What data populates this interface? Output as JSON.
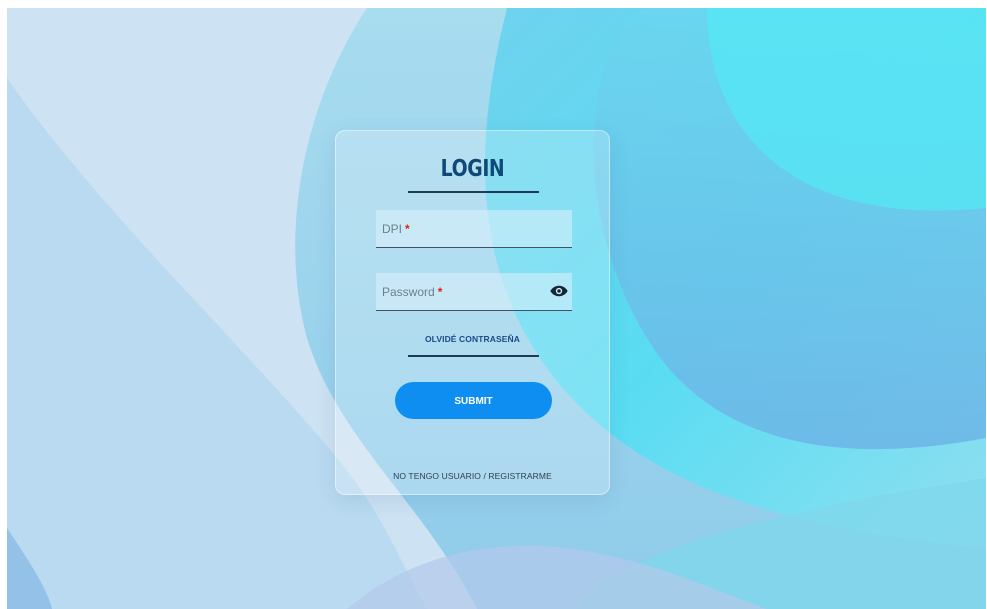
{
  "login": {
    "title": "LOGIN",
    "dpi_label": "DPI",
    "password_label": "Password",
    "required_mark": "*",
    "forgot_label": "OLVIDÉ CONTRASEÑA",
    "submit_label": "SUBMIT",
    "register_label": "NO TENGO USUARIO / REGISTRARME"
  },
  "icons": {
    "password_toggle": "eye-icon"
  },
  "colors": {
    "title": "#0f4978",
    "submit_button": "#0e8ef0",
    "required_mark": "#e0201e",
    "link": "#1d4a8a"
  }
}
